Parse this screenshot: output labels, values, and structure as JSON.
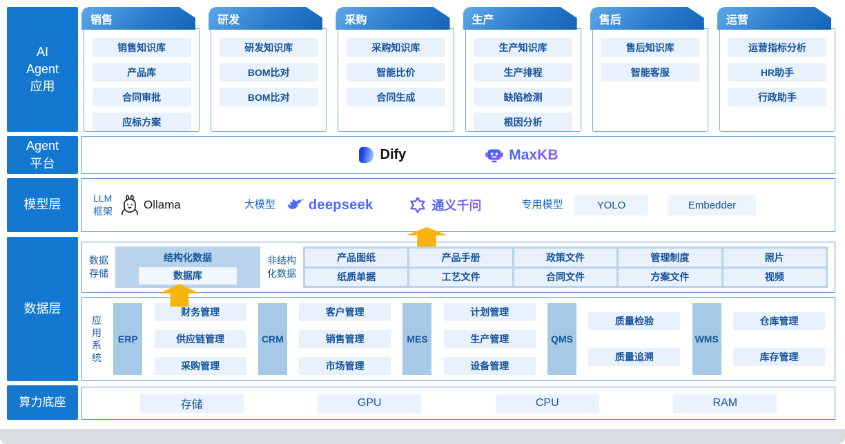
{
  "sidebar": {
    "layers": [
      {
        "label": "AI\nAgent\n应用"
      },
      {
        "label": "Agent\n平台"
      },
      {
        "label": "模型层"
      },
      {
        "label": "数据层"
      },
      {
        "label": "算力底座"
      }
    ]
  },
  "agent_apps": {
    "columns": [
      {
        "header": "销售",
        "items": [
          "销售知识库",
          "产品库",
          "合同审批",
          "应标方案"
        ]
      },
      {
        "header": "研发",
        "items": [
          "研发知识库",
          "BOM比对",
          "BOM比对"
        ]
      },
      {
        "header": "采购",
        "items": [
          "采购知识库",
          "智能比价",
          "合同生成"
        ]
      },
      {
        "header": "生产",
        "items": [
          "生产知识库",
          "生产排程",
          "缺陷检测",
          "根因分析"
        ]
      },
      {
        "header": "售后",
        "items": [
          "售后知识库",
          "智能客服"
        ]
      },
      {
        "header": "运营",
        "items": [
          "运营指标分析",
          "HR助手",
          "行政助手"
        ]
      }
    ]
  },
  "platform": {
    "dify_label": "Dify",
    "maxkb_label": "MaxKB"
  },
  "model_layer": {
    "llm_framework_label": "LLM\n框架",
    "ollama_label": "Ollama",
    "big_model_label": "大模型",
    "deepseek_label": "deepseek",
    "qwen_label": "通义千问",
    "special_model_label": "专用模型",
    "special_models": [
      "YOLO",
      "Embedder"
    ]
  },
  "data_layer": {
    "storage_label": "数据\n存储",
    "structured": {
      "title": "结构化数据",
      "item": "数据库"
    },
    "unstructured_label": "非结构\n化数据",
    "unstructured_rows": [
      [
        "产品图纸",
        "产品手册",
        "政策文件",
        "管理制度",
        "照片"
      ],
      [
        "纸质单据",
        "工艺文件",
        "合同文件",
        "方案文件",
        "视频"
      ]
    ],
    "app_systems_label": "应\n用\n系\n统",
    "systems": [
      {
        "name": "ERP",
        "items": [
          "财务管理",
          "供应链管理",
          "采购管理"
        ]
      },
      {
        "name": "CRM",
        "items": [
          "客户管理",
          "销售管理",
          "市场管理"
        ]
      },
      {
        "name": "MES",
        "items": [
          "计划管理",
          "生产管理",
          "设备管理"
        ]
      },
      {
        "name": "QMS",
        "items": [
          "质量检验",
          "质量追溯"
        ]
      },
      {
        "name": "WMS",
        "items": [
          "仓库管理",
          "库存管理"
        ]
      }
    ]
  },
  "compute_layer": {
    "items": [
      "存储",
      "GPU",
      "CPU",
      "RAM"
    ]
  },
  "icons": {
    "dify": "dify-logo",
    "maxkb": "maxkb-robot-icon",
    "ollama": "llama-icon",
    "deepseek": "deepseek-whale-icon",
    "qwen": "qwen-knot-icon",
    "arrow": "up-arrow"
  },
  "colors": {
    "layer_blue": "#1478d0",
    "border_blue": "#5b9bd5",
    "chip_bg": "#e9f2fc",
    "chip_text": "#16539c",
    "panel_bg": "#b9d3ec",
    "deepseek_blue": "#4D6BFE",
    "qwen_purple": "#615CE8",
    "maxkb_purple": "#7C4DFF",
    "arrow_yellow": "#F8B30C"
  }
}
